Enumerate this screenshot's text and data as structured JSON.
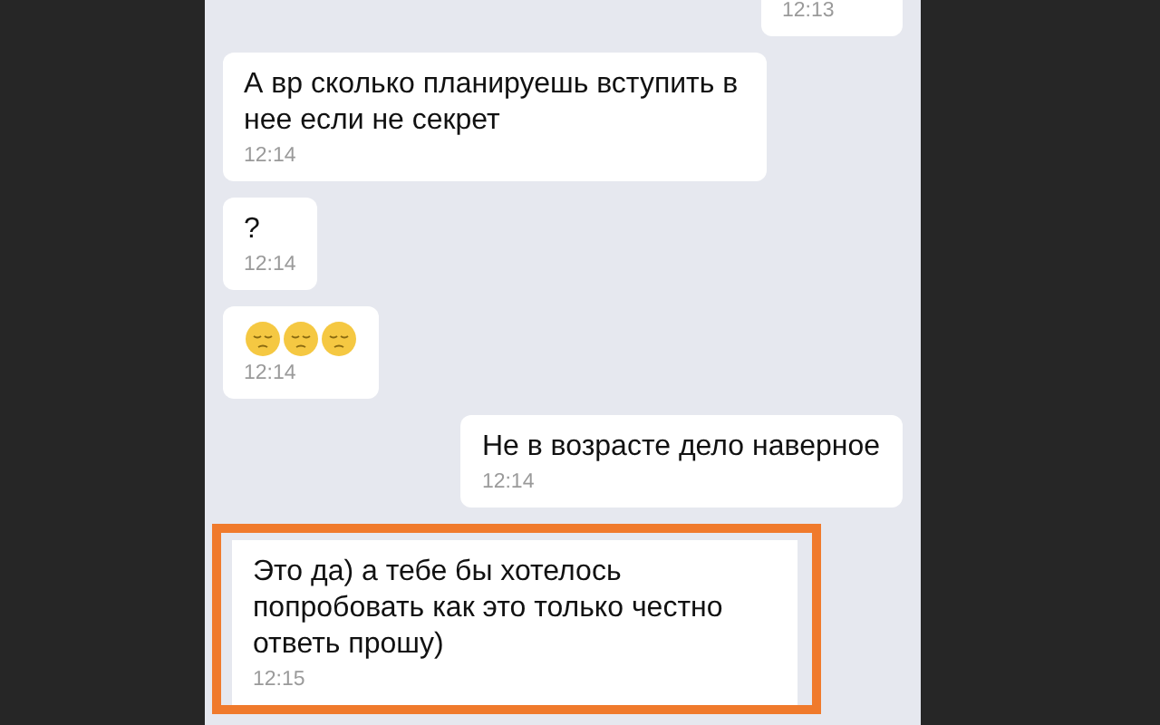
{
  "messages": [
    {
      "kind": "text",
      "outgoing": true,
      "highlighted": false,
      "time": "12:13"
    },
    {
      "kind": "text",
      "outgoing": false,
      "highlighted": false,
      "text": "А вр сколько планируешь вступить в нее если не секрет",
      "time": "12:14"
    },
    {
      "kind": "text",
      "outgoing": false,
      "highlighted": false,
      "text": "?",
      "time": "12:14"
    },
    {
      "kind": "emoji",
      "outgoing": false,
      "highlighted": false,
      "time": "12:14"
    },
    {
      "kind": "text",
      "outgoing": true,
      "highlighted": false,
      "text": "Не в возрасте дело наверное",
      "time": "12:14"
    },
    {
      "kind": "text",
      "outgoing": false,
      "highlighted": true,
      "text": "Это да) а тебе бы хотелось попробовать как это только честно ответь прошу)",
      "time": "12:15"
    }
  ]
}
